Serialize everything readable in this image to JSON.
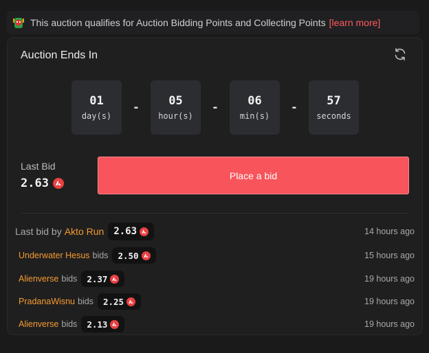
{
  "banner": {
    "icon": "mascot-badge-icon",
    "text": "This auction qualifies for Auction Bidding Points and Collecting Points",
    "link": "[learn more]"
  },
  "countdown": {
    "title": "Auction Ends In",
    "refresh_icon": "refresh-icon",
    "days": "01",
    "days_unit": "day(s)",
    "hours": "05",
    "hours_unit": "hour(s)",
    "mins": "06",
    "mins_unit": "min(s)",
    "secs": "57",
    "secs_unit": "seconds",
    "separator": "-"
  },
  "last_bid": {
    "label": "Last Bid",
    "value": "2.63",
    "currency_icon": "avax-icon"
  },
  "bid_button": {
    "label": "Place a bid"
  },
  "history": {
    "first": {
      "prefix": "Last bid by",
      "bidder": "Akto Run",
      "amount": "2.63",
      "time": "14 hours ago"
    },
    "rows": [
      {
        "bidder": "Underwater Hesus",
        "word": "bids",
        "amount": "2.50",
        "time": "15 hours ago"
      },
      {
        "bidder": "Alienverse",
        "word": "bids",
        "amount": "2.37",
        "time": "19 hours ago"
      },
      {
        "bidder": "PradanaWisnu",
        "word": "bids",
        "amount": "2.25",
        "time": "19 hours ago"
      },
      {
        "bidder": "Alienverse",
        "word": "bids",
        "amount": "2.13",
        "time": "19 hours ago"
      }
    ]
  },
  "colors": {
    "accent": "#f7545b",
    "bidder": "#f59b2e",
    "link": "#ff5a5f"
  }
}
